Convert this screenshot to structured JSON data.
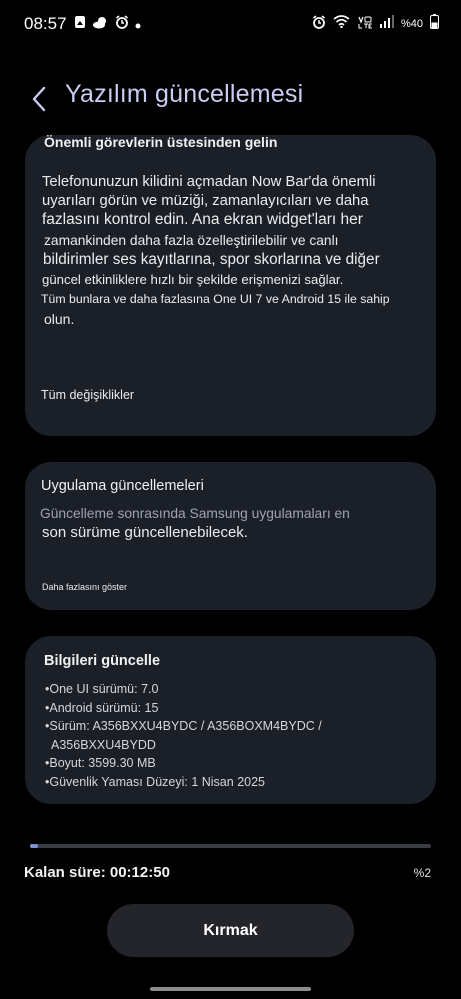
{
  "status_bar": {
    "time": "08:57",
    "battery": "%40",
    "left_icons": [
      "screenshot-icon",
      "weather-icon",
      "alarm-icon",
      "dot-icon"
    ],
    "right_icons": [
      "alarm-icon",
      "wifi-icon",
      "volte-icon",
      "signal-icon",
      "battery-icon"
    ]
  },
  "header": {
    "title": "Yazılım güncellemesi",
    "back_icon": "chevron-left-icon"
  },
  "card1": {
    "title": "Önemli görevlerin üstesinden gelin",
    "lines": [
      "Telefonunuzun kilidini açmadan Now Bar'da önemli",
      "uyarıları görün ve müziği, zamanlayıcıları ve daha",
      "fazlasını kontrol edin. Ana ekran widget'ları her",
      "zamankinden daha fazla özelleştirilebilir ve canlı",
      "bildirimler ses kayıtlarına, spor skorlarına ve diğer",
      "güncel etkinliklere hızlı bir şekilde erişmenizi sağlar.",
      "Tüm bunlara ve daha fazlasına One UI 7 ve Android 15 ile sahip",
      "olun."
    ],
    "link": "Tüm değişiklikler"
  },
  "card2": {
    "title": "Uygulama güncellemeleri",
    "lines": [
      "Güncelleme sonrasında Samsung uygulamaları en",
      "son sürüme güncellenebilecek."
    ],
    "link": "Daha fazlasını göster"
  },
  "card3": {
    "title": "Bilgileri güncelle",
    "items": [
      "•One UI sürümü: 7.0",
      "•Android sürümü: 15",
      "•Sürüm: A356BXXU4BYDC / A356BOXM4BYDC /",
      "A356BXXU4BYDD",
      "•Boyut: 3599.30 MB",
      "•Güvenlik Yaması Düzeyi: 1 Nisan 2025"
    ]
  },
  "progress": {
    "value_percent": 2,
    "label": "%2",
    "remaining": "Kalan süre: 00:12:50"
  },
  "button": {
    "label": "Kırmak"
  },
  "colors": {
    "accent": "#7d93d3",
    "title": "#c9cdf2",
    "card": "#1b1f28"
  }
}
